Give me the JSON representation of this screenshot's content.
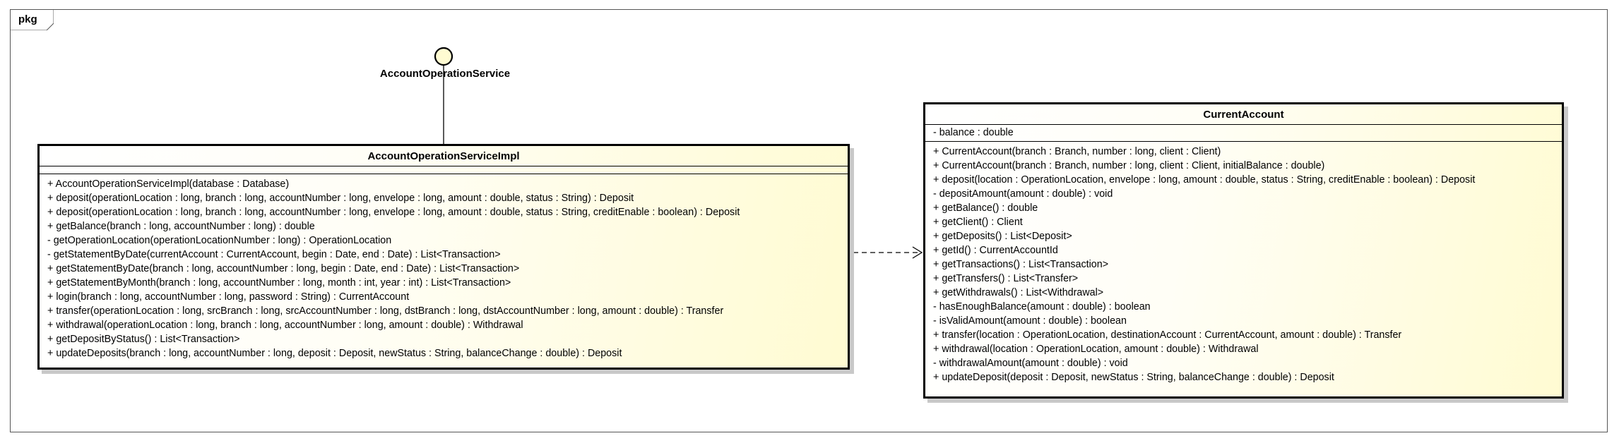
{
  "package": {
    "label": "pkg"
  },
  "interface": {
    "name": "AccountOperationService"
  },
  "classes": {
    "impl": {
      "name": "AccountOperationServiceImpl",
      "attributes": [],
      "operations": [
        "+ AccountOperationServiceImpl(database : Database)",
        "+ deposit(operationLocation : long, branch : long, accountNumber : long, envelope : long, amount : double, status : String) : Deposit",
        "+ deposit(operationLocation : long, branch : long, accountNumber : long, envelope : long, amount : double, status : String, creditEnable : boolean) : Deposit",
        "+ getBalance(branch : long, accountNumber : long) : double",
        "- getOperationLocation(operationLocationNumber : long) : OperationLocation",
        "- getStatementByDate(currentAccount : CurrentAccount, begin : Date, end : Date) : List<Transaction>",
        "+ getStatementByDate(branch : long, accountNumber : long, begin : Date, end : Date) : List<Transaction>",
        "+ getStatementByMonth(branch : long, accountNumber : long, month : int, year : int) : List<Transaction>",
        "+ login(branch : long, accountNumber : long, password : String) : CurrentAccount",
        "+ transfer(operationLocation : long, srcBranch : long, srcAccountNumber : long, dstBranch : long, dstAccountNumber : long, amount : double) : Transfer",
        "+ withdrawal(operationLocation : long, branch : long, accountNumber : long, amount : double) : Withdrawal",
        "+ getDepositByStatus() : List<Transaction>",
        "+ updateDeposits(branch : long, accountNumber : long, deposit : Deposit, newStatus : String, balanceChange : double) : Deposit"
      ]
    },
    "current": {
      "name": "CurrentAccount",
      "attributes": [
        "- balance : double"
      ],
      "operations": [
        "+ CurrentAccount(branch : Branch, number : long, client : Client)",
        "+ CurrentAccount(branch : Branch, number : long, client : Client, initialBalance : double)",
        "+ deposit(location : OperationLocation, envelope : long, amount : double, status : String, creditEnable : boolean) : Deposit",
        "- depositAmount(amount : double) : void",
        "+ getBalance() : double",
        "+ getClient() : Client",
        "+ getDeposits() : List<Deposit>",
        "+ getId() : CurrentAccountId",
        "+ getTransactions() : List<Transaction>",
        "+ getTransfers() : List<Transfer>",
        "+ getWithdrawals() : List<Withdrawal>",
        "- hasEnoughBalance(amount : double) : boolean",
        "- isValidAmount(amount : double) : boolean",
        "+ transfer(location : OperationLocation, destinationAccount : CurrentAccount, amount : double) : Transfer",
        "+ withdrawal(location : OperationLocation, amount : double) : Withdrawal",
        "- withdrawalAmount(amount : double) : void",
        "+ updateDeposit(deposit : Deposit, newStatus : String, balanceChange : double) : Deposit"
      ]
    }
  },
  "relations": [
    {
      "type": "realization-lollipop",
      "from": "AccountOperationServiceImpl",
      "to": "AccountOperationService"
    },
    {
      "type": "dependency",
      "from": "AccountOperationServiceImpl",
      "to": "CurrentAccount"
    }
  ]
}
